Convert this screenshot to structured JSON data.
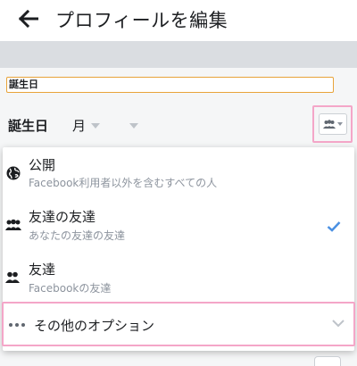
{
  "header": {
    "title": "プロフィールを編集"
  },
  "form": {
    "field_label": "誕生日",
    "birthday_label": "誕生日",
    "month_label": "月"
  },
  "audience_menu": {
    "options": [
      {
        "title": "公開",
        "subtitle": "Facebook利用者以外を含むすべての人"
      },
      {
        "title": "友達の友達",
        "subtitle": "あなたの友達の友達"
      },
      {
        "title": "友達",
        "subtitle": "Facebookの友達"
      }
    ],
    "more_label": "その他のオプション",
    "selected_index": 1
  },
  "colors": {
    "highlight": "#f4a6c8",
    "checkmark": "#4a90e2",
    "field_border": "#e8a33a"
  },
  "icons": {
    "back": "arrow-left-icon",
    "public": "globe-icon",
    "friends_of_friends": "friends-of-friends-icon",
    "friends": "friends-icon",
    "more": "ellipsis-icon",
    "selected": "check-icon",
    "expand": "chevron-down-icon"
  }
}
